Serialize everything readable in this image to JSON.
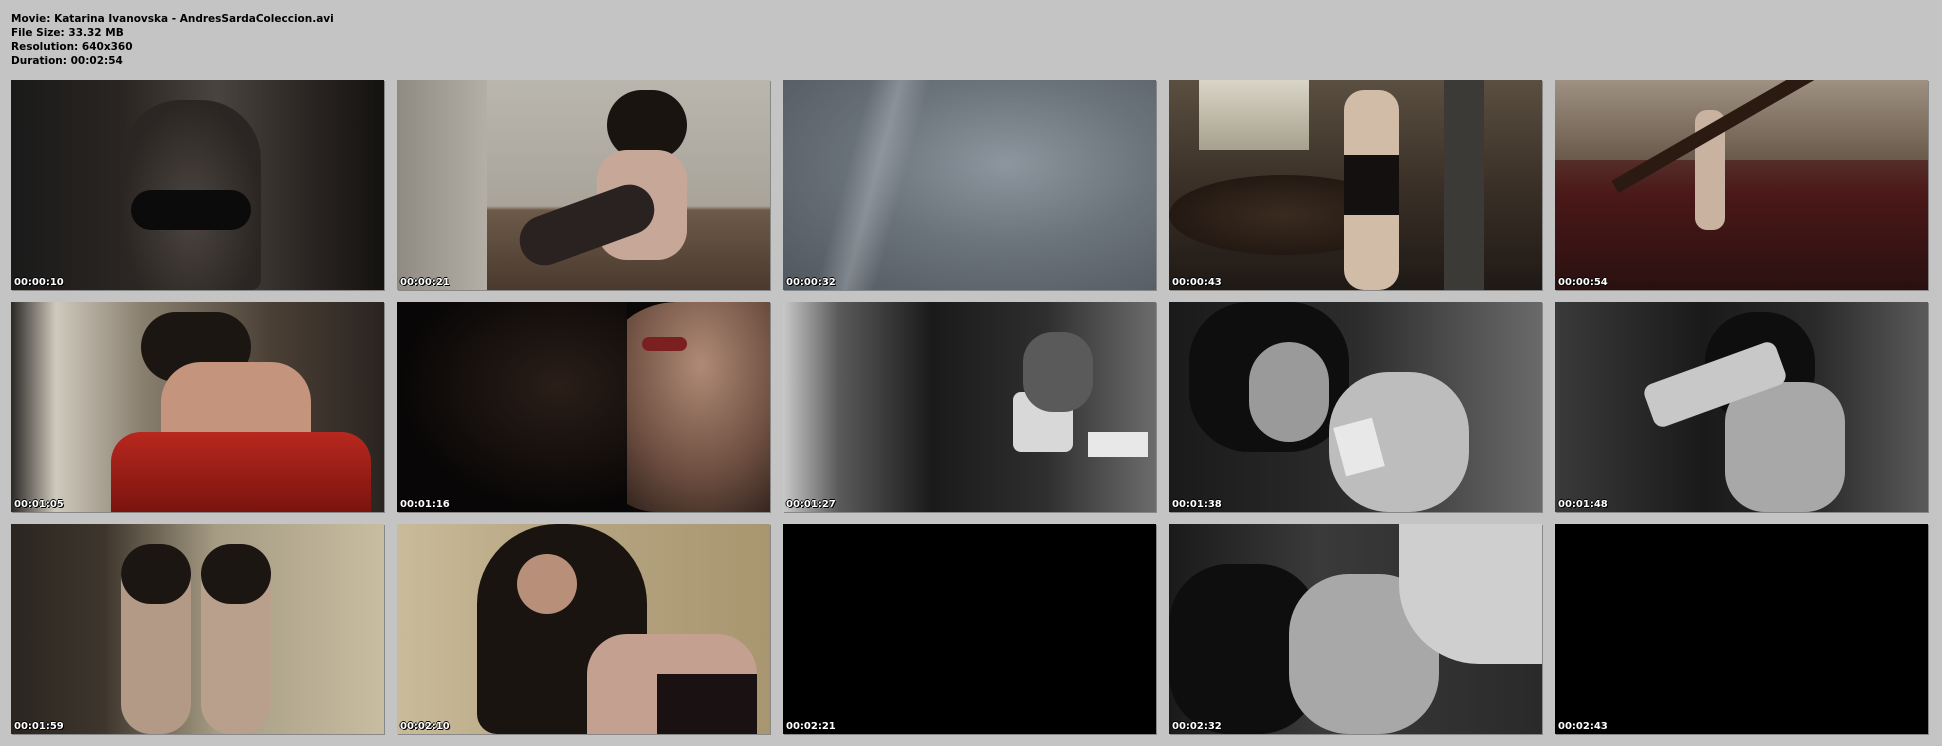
{
  "header": {
    "movie": "Movie: Katarina Ivanovska - AndresSardaColeccion.avi",
    "file_size": "File Size: 33.32 MB",
    "resolution": "Resolution: 640x360",
    "duration": "Duration: 00:02:54"
  },
  "frames": [
    {
      "time": "00:00:10"
    },
    {
      "time": "00:00:21"
    },
    {
      "time": "00:00:32"
    },
    {
      "time": "00:00:43"
    },
    {
      "time": "00:00:54"
    },
    {
      "time": "00:01:05"
    },
    {
      "time": "00:01:16"
    },
    {
      "time": "00:01:27"
    },
    {
      "time": "00:01:38"
    },
    {
      "time": "00:01:48"
    },
    {
      "time": "00:01:59"
    },
    {
      "time": "00:02:10"
    },
    {
      "time": "00:02:21"
    },
    {
      "time": "00:02:32"
    },
    {
      "time": "00:02:43"
    }
  ]
}
